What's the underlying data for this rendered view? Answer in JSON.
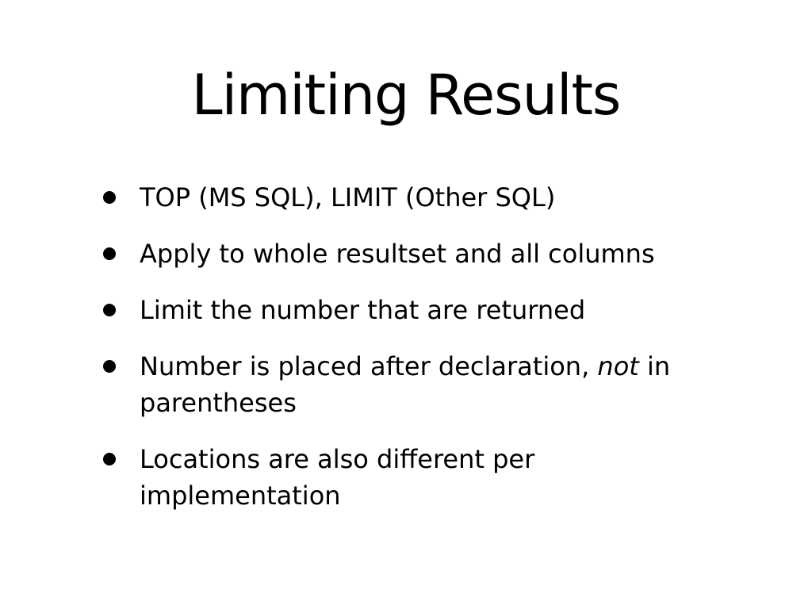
{
  "slide": {
    "title": "Limiting Results",
    "bullets": [
      {
        "pre": "TOP (MS SQL), LIMIT (Other SQL)",
        "emph": "",
        "post": ""
      },
      {
        "pre": "Apply to whole resultset and all columns",
        "emph": "",
        "post": ""
      },
      {
        "pre": "Limit the number that are returned",
        "emph": "",
        "post": ""
      },
      {
        "pre": "Number is placed after declaration, ",
        "emph": "not",
        "post": " in parentheses"
      },
      {
        "pre": "Locations are also different per implementation",
        "emph": "",
        "post": ""
      }
    ]
  }
}
